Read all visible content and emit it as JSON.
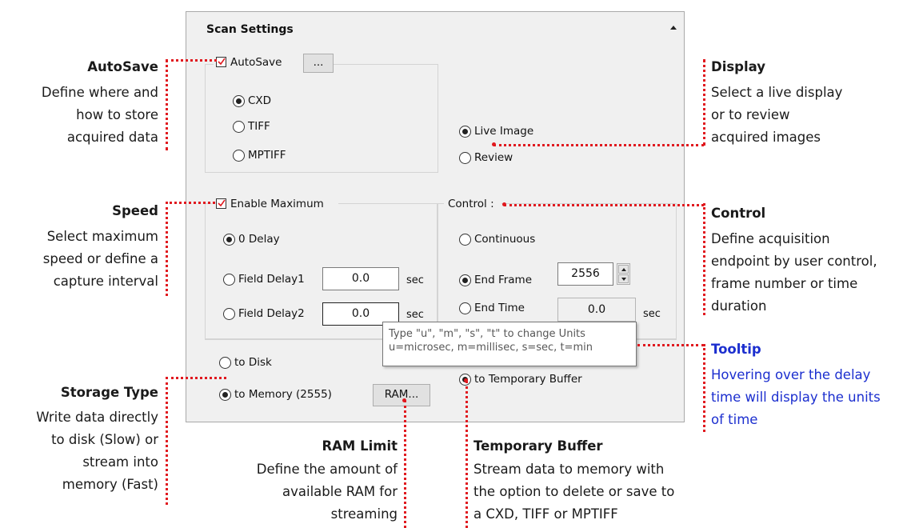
{
  "panel": {
    "title": "Scan Settings",
    "autosave": {
      "label": "AutoSave",
      "checked": true,
      "browse_label": "...",
      "formats": [
        "CXD",
        "TIFF",
        "MPTIFF"
      ],
      "selected_format": "CXD"
    },
    "display": {
      "options": [
        "Live Image",
        "Review"
      ],
      "selected": "Live Image"
    },
    "speed": {
      "label": "Enable Maximum",
      "checked": true,
      "options": [
        "0 Delay",
        "Field Delay1",
        "Field Delay2"
      ],
      "selected": "0 Delay",
      "delay1_value": "0.0",
      "delay2_value": "0.0",
      "unit": "sec"
    },
    "control": {
      "label": "Control :",
      "options": [
        "Continuous",
        "End Frame",
        "End Time"
      ],
      "selected": "End Frame",
      "end_frame_value": "2556",
      "end_time_value": "0.0",
      "unit": "sec"
    },
    "storage": {
      "options": [
        "to Disk",
        "to Memory (2555)",
        "to Temporary Buffer"
      ],
      "selected": "to Memory (2555)",
      "ram_button": "RAM..."
    },
    "tooltip": {
      "line1": "Type \"u\", \"m\", \"s\", \"t\" to change Units",
      "line2": "u=microsec, m=millisec, s=sec, t=min"
    }
  },
  "annotations": {
    "autosave": {
      "title": "AutoSave",
      "lines": [
        "Define where and",
        "how to store",
        "acquired data"
      ]
    },
    "speed": {
      "title": "Speed",
      "lines": [
        "Select maximum",
        "speed or define a",
        "capture interval"
      ]
    },
    "storage": {
      "title": "Storage Type",
      "lines": [
        "Write data directly",
        "to disk (Slow) or",
        "stream into",
        "memory (Fast)"
      ]
    },
    "ram": {
      "title": "RAM Limit",
      "lines": [
        "Define the amount of",
        "available RAM for",
        "streaming"
      ]
    },
    "buffer": {
      "title": "Temporary Buffer",
      "lines": [
        "Stream data to memory with",
        "the option to delete or save to",
        "a CXD, TIFF or MPTIFF"
      ]
    },
    "display": {
      "title": "Display",
      "lines": [
        "Select a live display",
        "or to review",
        "acquired images"
      ]
    },
    "control": {
      "title": "Control",
      "lines": [
        "Define acquisition",
        "endpoint by user control,",
        "frame number or time",
        "duration"
      ]
    },
    "tooltip": {
      "title": "Tooltip",
      "lines": [
        "Hovering over the delay",
        "time will display the units",
        "of time"
      ]
    }
  },
  "colors": {
    "annotation_dots": "#e0191f",
    "tooltip_note": "#1c2fcf"
  }
}
